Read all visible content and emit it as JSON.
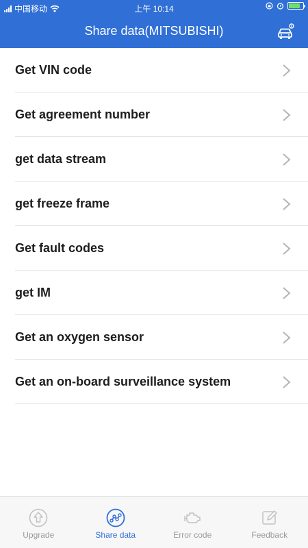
{
  "status_bar": {
    "carrier": "中国移动",
    "time": "上午 10:14"
  },
  "nav": {
    "title": "Share data(MITSUBISHI)",
    "action_icon": "car-settings-icon"
  },
  "menu": {
    "items": [
      {
        "label": "Get VIN code"
      },
      {
        "label": "Get agreement number"
      },
      {
        "label": "get data stream"
      },
      {
        "label": "get freeze frame"
      },
      {
        "label": "Get fault codes"
      },
      {
        "label": "get IM"
      },
      {
        "label": "Get an oxygen sensor"
      },
      {
        "label": "Get an on-board surveillance system"
      }
    ]
  },
  "tabs": [
    {
      "label": "Upgrade",
      "icon": "upgrade-icon",
      "active": false
    },
    {
      "label": "Share data",
      "icon": "share-data-icon",
      "active": true
    },
    {
      "label": "Error code",
      "icon": "engine-icon",
      "active": false
    },
    {
      "label": "Feedback",
      "icon": "edit-icon",
      "active": false
    }
  ],
  "colors": {
    "primary": "#2f6fd6",
    "inactive": "#9a9a9a",
    "divider": "#e3e3e3"
  }
}
